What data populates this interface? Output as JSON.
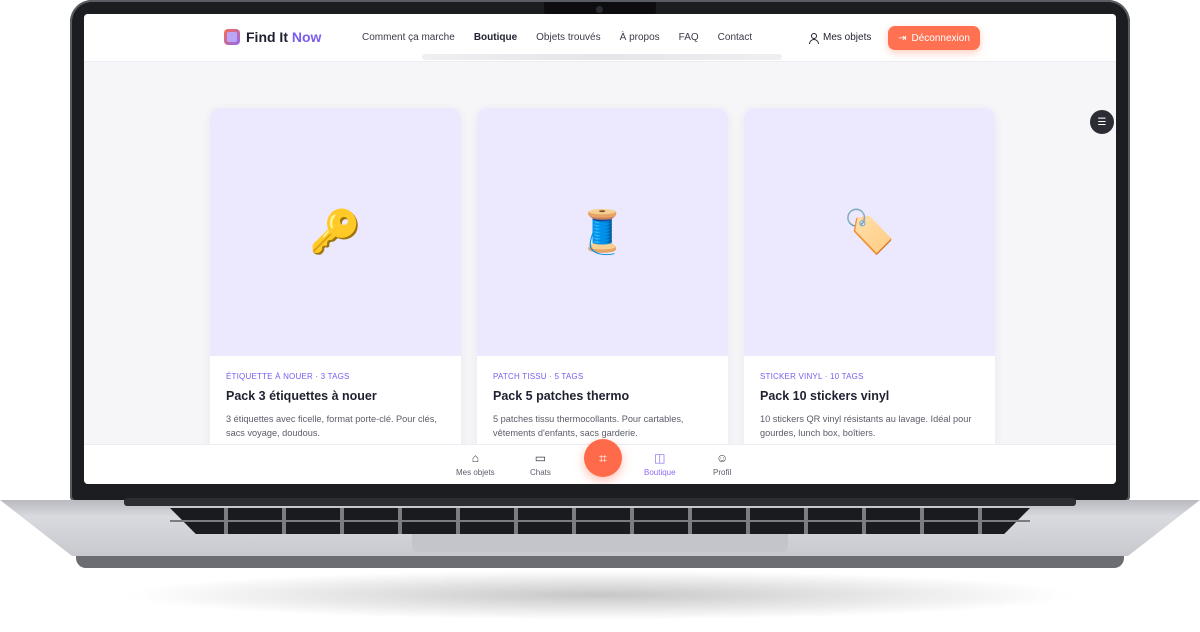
{
  "app": {
    "logo_main": "Find It ",
    "logo_accent": "Now"
  },
  "nav": {
    "items": [
      "Comment ça marche",
      "Boutique",
      "Objets trouvés",
      "À propos",
      "FAQ",
      "Contact"
    ],
    "active": "Boutique",
    "my_items": "Mes objets",
    "logout": "Déconnexion"
  },
  "products": [
    {
      "tag": "ÉTIQUETTE À NOUER · 3 TAGS",
      "title": "Pack 3 étiquettes à nouer",
      "desc": "3 étiquettes avec ficelle, format porte-clé. Pour clés, sacs voyage, doudous.",
      "icon": "key-icon",
      "emoji": "🔑"
    },
    {
      "tag": "PATCH TISSU · 5 TAGS",
      "title": "Pack 5 patches thermo",
      "desc": "5 patches tissu thermocollants. Pour cartables, vêtements d'enfants, sacs garderie.",
      "icon": "thread-spool-icon",
      "emoji": "🧵"
    },
    {
      "tag": "STICKER VINYL · 10 TAGS",
      "title": "Pack 10 stickers vinyl",
      "desc": "10 stickers QR vinyl résistants au lavage. Idéal pour gourdes, lunch box, boîtiers.",
      "icon": "label-tag-icon",
      "emoji": "🏷️"
    }
  ],
  "tabbar": {
    "items": [
      "Mes objets",
      "Chats",
      "Boutique",
      "Profil"
    ],
    "active": "Boutique",
    "icons": [
      "home-icon",
      "chat-icon",
      "shop-bag-icon",
      "profile-icon"
    ],
    "scan_icon": "qr-scan-icon"
  },
  "colors": {
    "accent": "#7b5cf0",
    "cta": "#ff7151",
    "card_visual_bg": "#ece8fe"
  }
}
